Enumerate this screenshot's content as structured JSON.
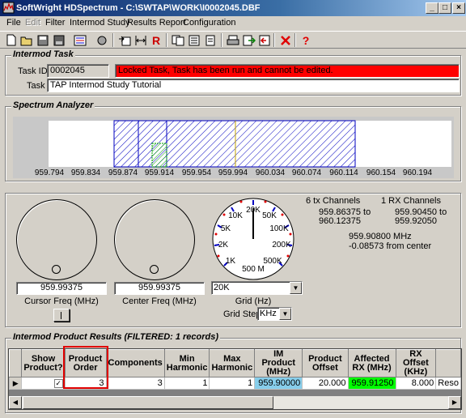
{
  "window": {
    "title": "SoftWright HDSpectrum - C:\\SWTAP\\WORK\\I0002045.DBF"
  },
  "menu": {
    "items": [
      "File",
      "Edit",
      "Filter",
      "Intermod Study",
      "Results Report",
      "Configuration"
    ]
  },
  "toolbar": {
    "icons": [
      "new-icon",
      "open-icon",
      "save-icon",
      "save-as-icon",
      "list-icon",
      "tools-icon",
      "import-icon",
      "bandwidth-icon",
      "r-icon",
      "copy-icon",
      "report-icon",
      "page-icon",
      "print-icon",
      "export-icon",
      "exit-icon",
      "close-icon",
      "help-icon"
    ],
    "r_label": "R",
    "help_label": "?"
  },
  "intermod_task": {
    "group_title": "Intermod Task",
    "task_id_label": "Task ID:",
    "task_id": "0002045",
    "locked_message": "Locked Task, Task has been run and cannot be edited.",
    "task_label": "Task",
    "task_name": "TAP Intermod Study Tutorial"
  },
  "spectrum": {
    "group_title": "Spectrum Analyzer",
    "ticks": [
      "959.794",
      "959.834",
      "959.874",
      "959.914",
      "959.954",
      "959.994",
      "960.034",
      "960.074",
      "960.114",
      "960.154",
      "960.194"
    ]
  },
  "controls": {
    "cursor_freq_value": "959.99375",
    "cursor_freq_label": "Cursor Freq (MHz)",
    "center_freq_value": "959.99375",
    "center_freq_label": "Center Freq (MHz)",
    "grid_value": "20K",
    "grid_label": "Grid (Hz)",
    "grid_step_label": "Grid Step",
    "grid_step_value": "KHz",
    "dial_labels": [
      "20K",
      "50K",
      "100K",
      "200K",
      "500K",
      "500 M",
      "1K",
      "2K",
      "5K",
      "10K"
    ],
    "tx_channels": "6 tx Channels",
    "tx_range_from": "959.86375 to",
    "tx_range_to": "960.12375",
    "rx_channels": "1 RX Channels",
    "rx_range_from": "959.90450 to",
    "rx_range_to": "959.92050",
    "freq_mhz": "959.90800 MHz",
    "from_center": "-0.08573 from center"
  },
  "results": {
    "group_title": "Intermod Product Results (FILTERED: 1 records)",
    "columns": [
      "Show Product?",
      "Product Order",
      "Components",
      "Min Harmonic",
      "Max Harmonic",
      "IM Product (MHz)",
      "Product Offset",
      "Affected RX (MHz)",
      "RX Offset (KHz)",
      ""
    ],
    "rows": [
      {
        "show_product": "✓",
        "product_order": "3",
        "components": "3",
        "min_harmonic": "1",
        "max_harmonic": "1",
        "im_product": "959.90000",
        "product_offset": "20.000",
        "affected_rx": "959.91250",
        "rx_offset": "8.000",
        "extra": "Reso"
      }
    ]
  },
  "colors": {
    "locked_bg": "#ff0000",
    "im_product_bg": "#87ceeb",
    "affected_rx_bg": "#00ff00",
    "highlight_box": "#e00000",
    "spectrum_hatch": "#0000c0",
    "rx_hatch": "#00a000"
  }
}
